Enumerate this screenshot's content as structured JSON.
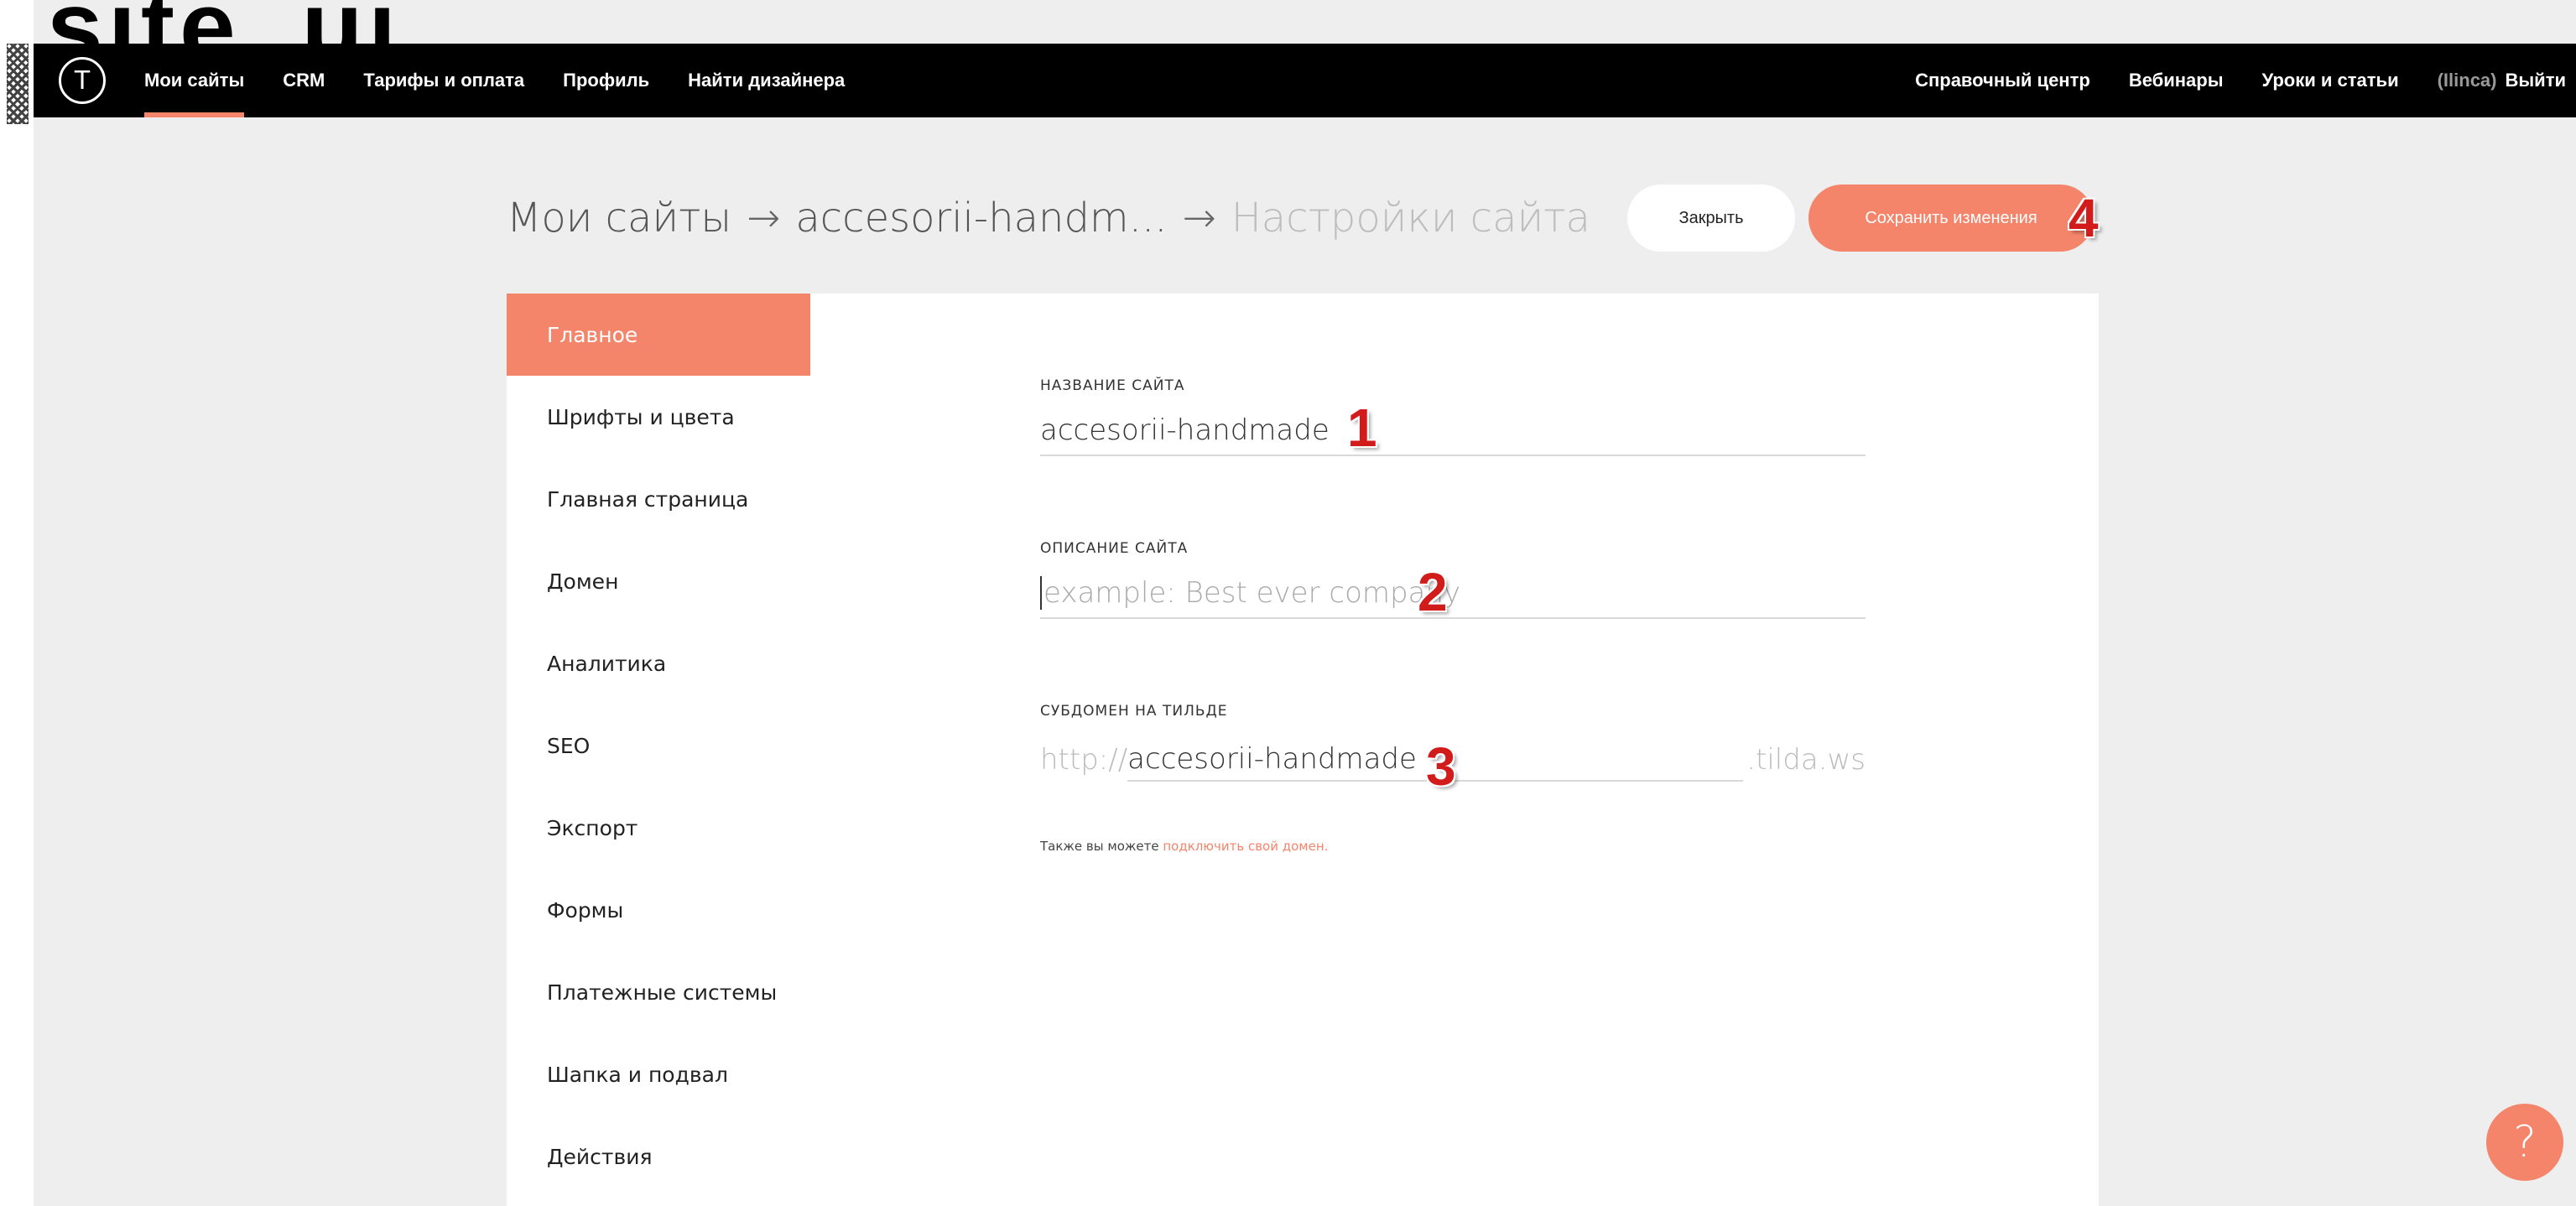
{
  "overlay": {
    "text": "site_ui"
  },
  "nav": {
    "logo_glyph": "Т",
    "left": [
      "Мои сайты",
      "CRM",
      "Тарифы и оплата",
      "Профиль",
      "Найти дизайнера"
    ],
    "right": [
      "Справочный центр",
      "Вебинары",
      "Уроки и статьи"
    ],
    "user": "(Ilinca)",
    "logout": "Выйти",
    "active_index": 0
  },
  "breadcrumb": {
    "root": "Мои сайты",
    "sep": "→",
    "site": "accesorii-handm...",
    "current": "Настройки сайта"
  },
  "actions": {
    "close_label": "Закрыть",
    "save_label": "Сохранить изменения"
  },
  "markers": [
    "1",
    "2",
    "3",
    "4"
  ],
  "sidebar": {
    "items": [
      "Главное",
      "Шрифты и цвета",
      "Главная страница",
      "Домен",
      "Аналитика",
      "SEO",
      "Экспорт",
      "Формы",
      "Платежные системы",
      "Шапка и подвал",
      "Действия"
    ],
    "active_index": 0
  },
  "form": {
    "site_name": {
      "label": "Название сайта",
      "value": "accesorii-handmade"
    },
    "site_description": {
      "label": "Описание сайта",
      "placeholder": "example: Best ever company"
    },
    "subdomain": {
      "label": "Субдомен на Тильде",
      "prefix": "http://",
      "value": "accesorii-handmade",
      "suffix": ".tilda.ws"
    },
    "hint_prefix": "Также вы можете ",
    "hint_link": "подключить свой домен."
  },
  "help": {
    "glyph": "?"
  },
  "colors": {
    "accent": "#f4846a",
    "topbar": "#000000",
    "background": "#eeeeee",
    "marker": "#d21b1b"
  }
}
